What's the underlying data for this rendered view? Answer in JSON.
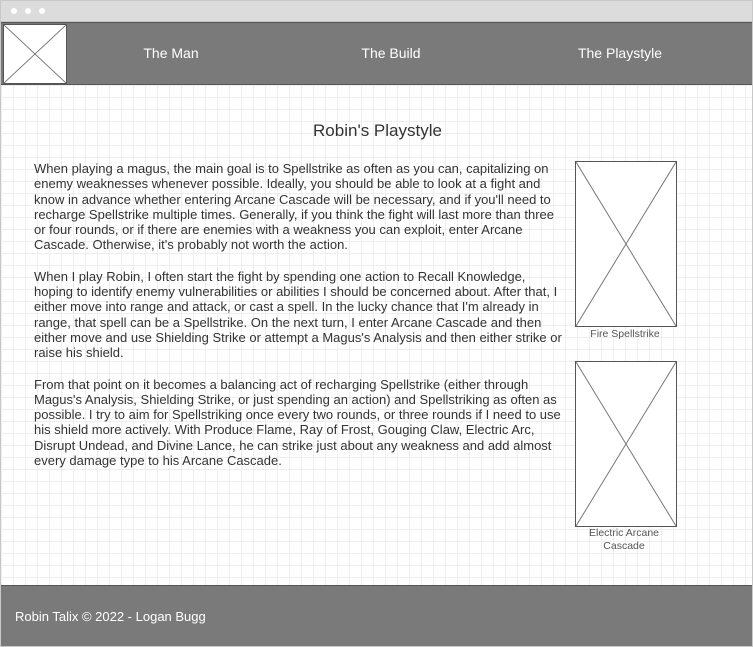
{
  "nav": {
    "items": [
      {
        "label": "The Man"
      },
      {
        "label": "The Build"
      },
      {
        "label": "The Playstyle"
      }
    ]
  },
  "main": {
    "title": "Robin's Playstyle",
    "paragraphs": [
      "When playing a magus, the main goal is to Spellstrike as often as you can, capitalizing on enemy weaknesses whenever possible. Ideally, you should be able to look at a fight and know in advance whether entering Arcane Cascade will be necessary, and if you'll need to recharge Spellstrike multiple times. Generally, if you think the fight will last more than three or four rounds, or if there are enemies with a weakness you can exploit, enter Arcane Cascade. Otherwise, it's probably not worth the action.",
      "When I play Robin, I often start the fight by spending one action to Recall Knowledge, hoping to identify enemy vulnerabilities or abilities I should be concerned about. After that, I either move into range and attack, or cast a spell. In the lucky chance that I'm already in range, that spell can be a Spellstrike. On the next turn, I enter Arcane Cascade and then either move and use Shielding Strike or attempt a Magus's Analysis and then either strike or raise his shield.",
      "From that point on it becomes a balancing act of recharging Spellstrike (either through Magus's Analysis, Shielding Strike, or just spending an action) and Spellstriking as often as possible. I try to aim for Spellstriking once every two rounds, or three rounds if I need to use his shield more actively. With Produce Flame, Ray of Frost, Gouging Claw, Electric Arc, Disrupt Undead, and Divine Lance, he can strike just about any weakness and add almost every damage type to his Arcane Cascade."
    ],
    "figures": [
      {
        "caption": "Fire Spellstrike"
      },
      {
        "caption": "Electric Arcane Cascade"
      }
    ]
  },
  "footer": {
    "text": "Robin Talix © 2022 - Logan Bugg"
  }
}
